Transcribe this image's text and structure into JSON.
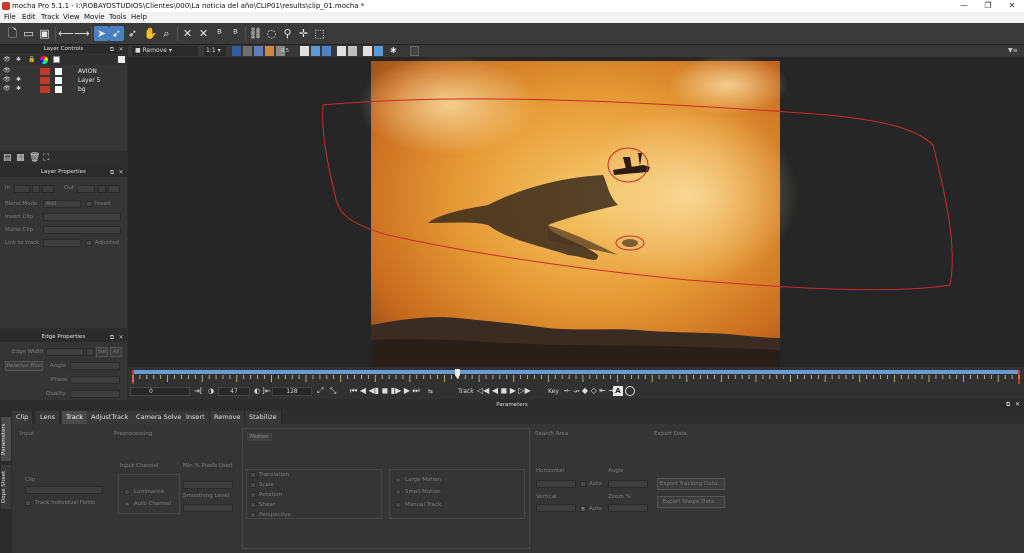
{
  "window": {
    "title": "mocha Pro 5.1.1 - I:\\ROBAYOSTUDIOS\\Clientes\\000\\La noticia del año\\CLIP01\\results\\clip_01.mocha *",
    "min": "—",
    "max": "❐",
    "close": "✕"
  },
  "menu": [
    "File",
    "Edit",
    "Track",
    "View",
    "Movie",
    "Tools",
    "Help"
  ],
  "layer_controls": {
    "title": "Layer Controls",
    "layers": [
      {
        "name": "AVION",
        "color": "#c0392b"
      },
      {
        "name": "Layer 5",
        "color": "#c0392b"
      },
      {
        "name": "bg",
        "color": "#c0392b"
      }
    ]
  },
  "layer_properties": {
    "title": "Layer Properties",
    "in_label": "In",
    "out_label": "Out",
    "blend_mode_label": "Blend Mode",
    "blend_mode_value": "Add",
    "invert_label": "Invert",
    "insert_clip_label": "Insert Clip",
    "matte_clip_label": "Matte Clip",
    "link_label": "Link to track",
    "adjusted_label": "Adjusted"
  },
  "edge_properties": {
    "title": "Edge Properties",
    "edge_width_label": "Edge Width",
    "set_label": "Set",
    "all_label": "All",
    "relative_label": "Relative Blur",
    "angle_label": "Angle",
    "phase_label": "Phase",
    "quality_label": "Quality"
  },
  "viewer": {
    "view_mode": "Remove",
    "zoom": "1:1",
    "opacity": "0.5"
  },
  "timeline": {
    "start": "0",
    "current": "47",
    "end": "128",
    "track_label": "Track",
    "key_label": "Key"
  },
  "parameters": {
    "title": "Parameters",
    "tabs": [
      "Clip",
      "Lens",
      "Track",
      "AdjustTrack",
      "Camera Solve",
      "Insert",
      "Remove",
      "Stabilize"
    ],
    "side_tabs": [
      "Parameters",
      "Dope Sheet"
    ],
    "input": {
      "title": "Input",
      "clip_label": "Clip",
      "track_individual": "Track Individual Fields"
    },
    "preprocessing": {
      "title": "Preprocessing",
      "input_channel_label": "Input Channel",
      "luminance": "Luminance",
      "auto_channel": "Auto Channel",
      "min_pixels_label": "Min % Pixels Used",
      "smoothing_label": "Smoothing Level"
    },
    "motion": {
      "title": "Motion",
      "options": [
        "Translation",
        "Scale",
        "Rotation",
        "Shear",
        "Perspective"
      ],
      "motion_types": [
        "Large Motion",
        "Small Motion",
        "Manual Track"
      ]
    },
    "search_area": {
      "title": "Search Area",
      "horizontal_label": "Horizontal",
      "vertical_label": "Vertical",
      "auto": "Auto",
      "angle_label": "Angle",
      "zoom_label": "Zoom %"
    },
    "export_data": {
      "title": "Export Data",
      "btn1": "Export Tracking Data...",
      "btn2": "Export Shape Data..."
    }
  }
}
